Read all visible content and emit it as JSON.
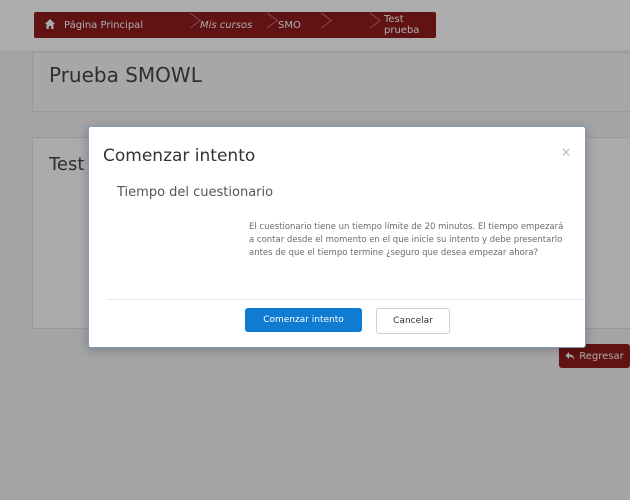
{
  "breadcrumb": {
    "items": [
      {
        "label": "Página Principal",
        "icon": "home-icon"
      },
      {
        "label": "Mis cursos"
      },
      {
        "label": "SMO"
      },
      {
        "label": "Test prueba"
      }
    ]
  },
  "page": {
    "title": "Prueba SMOWL",
    "section_title": "Test",
    "back_button": "Regresar"
  },
  "modal": {
    "title": "Comenzar intento",
    "close_symbol": "×",
    "heading": "Tiempo del cuestionario",
    "body": "El cuestionario tiene un tiempo límite de 20 minutos. El tiempo empezará a contar desde el momento en el que inicie su intento y debe presentarlo antes de que el tiempo termine ¿seguro que desea empezar ahora?",
    "primary_button": "Comenzar intento",
    "secondary_button": "Cancelar"
  },
  "colors": {
    "brand_maroon": "#8f1b1b",
    "primary_blue": "#0f7bd1"
  }
}
